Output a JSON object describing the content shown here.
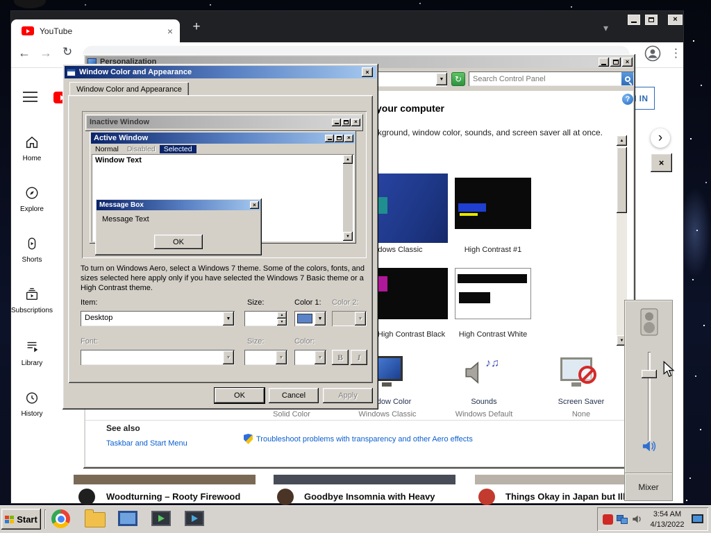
{
  "colors": {
    "classic_gray": "#d4d0c8",
    "title_active_left": "#0a246a",
    "title_active_right": "#a6caf0",
    "youtube_red": "#ff0000",
    "link_blue": "#0b5fce",
    "color1_swatch": "#5b84c8",
    "selection_navy": "#0a246a"
  },
  "icons": {
    "close": "×",
    "down": "▼",
    "up": "▲",
    "back": "←",
    "forward": "→",
    "reload": "↻",
    "plus": "+",
    "chev_down": "▾",
    "chev_right": "›",
    "kebab": "⋮",
    "help": "?",
    "notes": "♪♫"
  },
  "browser": {
    "tab_title": "YouTube",
    "sign_in": "SIGN IN",
    "sidebar": {
      "items": [
        {
          "label": "Home"
        },
        {
          "label": "Explore"
        },
        {
          "label": "Shorts"
        },
        {
          "label": "Subscriptions"
        },
        {
          "label": "Library"
        },
        {
          "label": "History"
        }
      ]
    },
    "videos": [
      {
        "title": "Woodturning – Rooty Firewood"
      },
      {
        "title": "Goodbye Insomnia with Heavy"
      },
      {
        "title": "Things Okay in Japan but Ill"
      }
    ]
  },
  "personalization": {
    "title": "Personalization",
    "search_placeholder": "Search Control Panel",
    "heading": "Change the visuals and sounds on your computer",
    "subheading": "Click a theme to change the desktop background, window color, sounds, and screen saver all at once.",
    "themes": [
      {
        "label": "Windows Classic"
      },
      {
        "label": "High Contrast #1"
      },
      {
        "label": "High Contrast Black"
      },
      {
        "label": "High Contrast White"
      }
    ],
    "shortcuts": [
      {
        "label": "",
        "value": "Solid Color"
      },
      {
        "label": "Window Color",
        "value": "Windows Classic"
      },
      {
        "label": "Sounds",
        "value": "Windows Default"
      },
      {
        "label": "Screen Saver",
        "value": "None"
      }
    ],
    "see_also_title": "See also",
    "see_also_link": "Taskbar and Start Menu",
    "troubleshoot_link": "Troubleshoot problems with transparency and other Aero effects"
  },
  "dialog": {
    "title": "Window Color and Appearance",
    "tab_label": "Window Color and Appearance",
    "preview": {
      "inactive_title": "Inactive Window",
      "active_title": "Active Window",
      "menu": [
        "Normal",
        "Disabled",
        "Selected"
      ],
      "window_text": "Window Text",
      "msgbox_title": "Message Box",
      "msgbox_text": "Message Text",
      "msgbox_ok": "OK"
    },
    "instruction": "To turn on Windows Aero, select a Windows 7 theme.  Some of the colors, fonts, and sizes selected here apply only if you have selected the Windows 7 Basic theme or a High Contrast theme.",
    "fields": {
      "item_label": "Item:",
      "item_value": "Desktop",
      "size1_label": "Size:",
      "color1_label": "Color 1:",
      "color2_label": "Color 2:",
      "font_label": "Font:",
      "size2_label": "Size:",
      "fontcolor_label": "Color:",
      "bold": "B",
      "italic": "I"
    },
    "buttons": {
      "ok": "OK",
      "cancel": "Cancel",
      "apply": "Apply"
    }
  },
  "mixer": {
    "label": "Mixer"
  },
  "taskbar": {
    "start": "Start",
    "time": "3:54 AM",
    "date": "4/13/2022"
  }
}
